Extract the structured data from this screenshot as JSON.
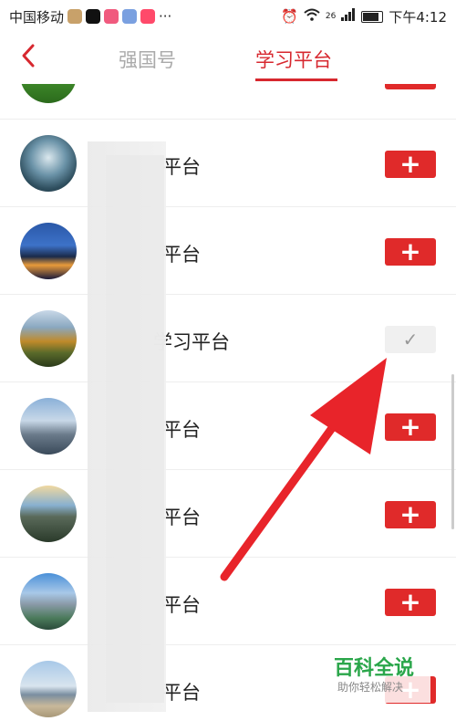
{
  "statusbar": {
    "carrier": "中国移动",
    "network_label": "26",
    "time": "下午4:12",
    "dots": "···"
  },
  "header": {
    "tabs": [
      {
        "label": "强国号",
        "active": false
      },
      {
        "label": "学习平台",
        "active": true
      }
    ]
  },
  "list": {
    "items": [
      {
        "name": "平台",
        "action": "add",
        "action_symbol": "+"
      },
      {
        "name": "平台",
        "action": "add",
        "action_symbol": "+"
      },
      {
        "name": "学习平台",
        "action": "added",
        "action_symbol": "✓"
      },
      {
        "name": "平台",
        "action": "add",
        "action_symbol": "+"
      },
      {
        "name": "平台",
        "action": "add",
        "action_symbol": "+"
      },
      {
        "name": "平台",
        "action": "add",
        "action_symbol": "+"
      },
      {
        "name": "平台",
        "action": "add",
        "action_symbol": "+"
      }
    ]
  },
  "watermark": {
    "title": "百科全说",
    "subtitle": "助你轻松解决"
  },
  "colors": {
    "accent": "#d7282f",
    "button": "#e02a2a",
    "arrow": "#e8242a",
    "watermark_green": "#2aa64a"
  }
}
